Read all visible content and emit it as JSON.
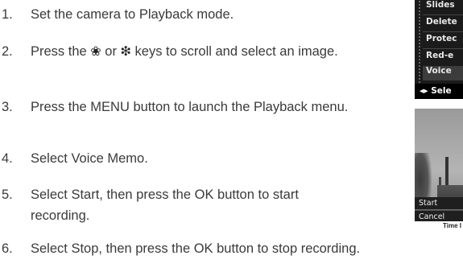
{
  "steps": [
    {
      "num": "1.",
      "text": "Set the camera to Playback mode."
    },
    {
      "num": "2.",
      "pre": "Press the ",
      "key1": "❤",
      "mid": " or ",
      "key2": "⚡",
      "post": " keys to scroll and select an image."
    },
    {
      "num": "3.",
      "text": "Press the MENU button to launch the Playback menu."
    },
    {
      "num": "4.",
      "text": "Select Voice Memo."
    },
    {
      "num": "5.",
      "text": "Select Start, then press the OK button to start recording."
    },
    {
      "num": "6.",
      "text": "Select Stop, then press the OK button to stop recording."
    }
  ],
  "menu_screen": {
    "items": [
      "Slides",
      "Delete",
      "Protec",
      "Red-e",
      "Voice"
    ],
    "footer": "◂▸ Sele"
  },
  "voice_memo_screen": {
    "start_label": "Start",
    "cancel_label": "Cancel",
    "caption": "Time I"
  }
}
